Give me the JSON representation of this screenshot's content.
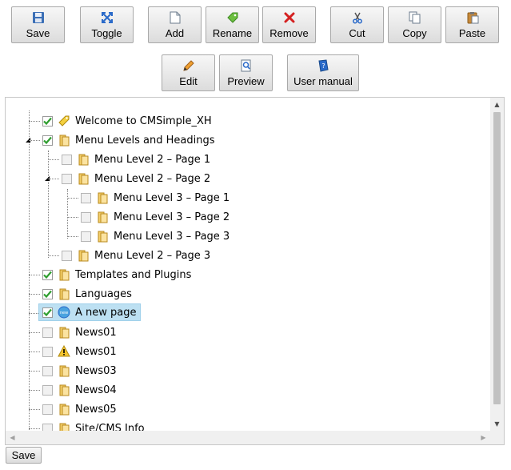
{
  "toolbar": {
    "row1": [
      {
        "key": "save",
        "label": "Save",
        "icon": "floppy-disk-icon"
      },
      {
        "key": "toggle",
        "label": "Toggle",
        "icon": "expand-arrows-icon"
      },
      {
        "key": "add",
        "label": "Add",
        "icon": "new-page-icon"
      },
      {
        "key": "rename",
        "label": "Rename",
        "icon": "tag-icon"
      },
      {
        "key": "remove",
        "label": "Remove",
        "icon": "red-x-icon"
      },
      {
        "key": "cut",
        "label": "Cut",
        "icon": "scissors-icon"
      },
      {
        "key": "copy",
        "label": "Copy",
        "icon": "copy-pages-icon"
      },
      {
        "key": "paste",
        "label": "Paste",
        "icon": "clipboard-icon"
      }
    ],
    "row2": [
      {
        "key": "edit",
        "label": "Edit",
        "icon": "pencil-icon"
      },
      {
        "key": "preview",
        "label": "Preview",
        "icon": "magnifier-page-icon"
      },
      {
        "key": "manual",
        "label": "User manual",
        "icon": "help-book-icon"
      }
    ]
  },
  "tree": {
    "nodes": [
      {
        "label": "Welcome to CMSimple_XH",
        "checked": true,
        "icon": "yellow-tag-icon"
      },
      {
        "label": "Menu Levels and Headings",
        "checked": true,
        "icon": "folder-icon"
      },
      {
        "label": "Menu Level 2 – Page 1",
        "checked": false,
        "icon": "folder-icon"
      },
      {
        "label": "Menu Level 2 – Page 2",
        "checked": false,
        "icon": "folder-icon"
      },
      {
        "label": "Menu Level 3 – Page 1",
        "checked": false,
        "icon": "folder-icon"
      },
      {
        "label": "Menu Level 3 – Page 2",
        "checked": false,
        "icon": "folder-icon"
      },
      {
        "label": "Menu Level 3 – Page 3",
        "checked": false,
        "icon": "folder-icon"
      },
      {
        "label": "Menu Level 2 – Page 3",
        "checked": false,
        "icon": "folder-icon"
      },
      {
        "label": "Templates and Plugins",
        "checked": true,
        "icon": "folder-icon"
      },
      {
        "label": "Languages",
        "checked": true,
        "icon": "folder-icon"
      },
      {
        "label": "A new page",
        "checked": true,
        "icon": "new-badge-icon",
        "selected": true
      },
      {
        "label": "News01",
        "checked": false,
        "icon": "folder-icon"
      },
      {
        "label": "News01",
        "checked": false,
        "icon": "warning-icon"
      },
      {
        "label": "News03",
        "checked": false,
        "icon": "folder-icon"
      },
      {
        "label": "News04",
        "checked": false,
        "icon": "folder-icon"
      },
      {
        "label": "News05",
        "checked": false,
        "icon": "folder-icon"
      },
      {
        "label": "Site/CMS Info",
        "checked": false,
        "icon": "folder-icon"
      }
    ]
  },
  "footer": {
    "save_label": "Save"
  },
  "colors": {
    "selection": "#bde0f2",
    "check_green": "#2f9e2f",
    "folder": "#e8b93c"
  }
}
